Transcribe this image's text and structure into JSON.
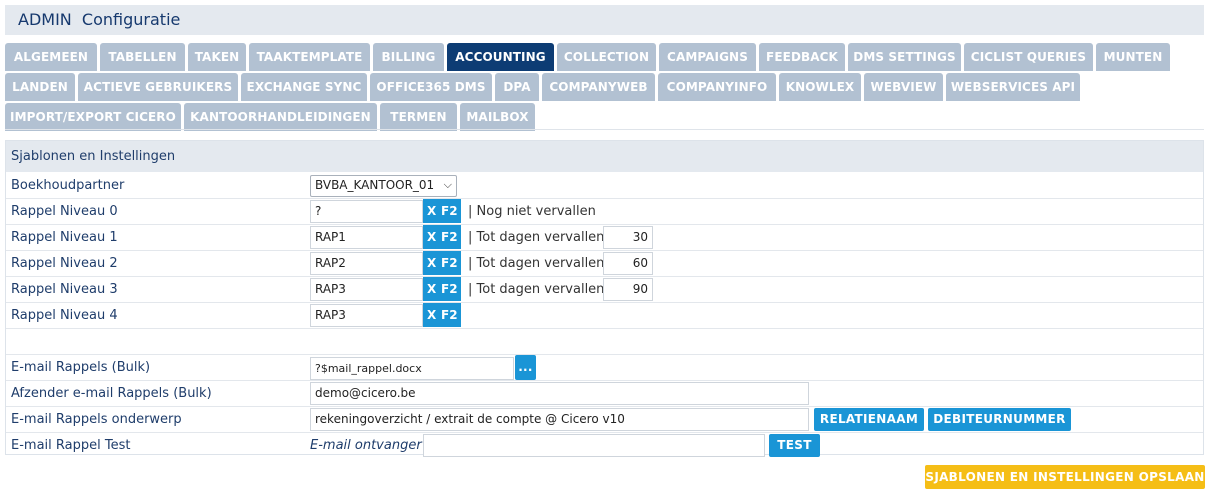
{
  "header": {
    "title": "ADMIN  Configuratie"
  },
  "tabs": {
    "row1": [
      "ALGEMEEN",
      "TABELLEN",
      "TAKEN",
      "TAAKTEMPLATE",
      "BILLING",
      "ACCOUNTING",
      "COLLECTION",
      "CAMPAIGNS",
      "FEEDBACK",
      "DMS SETTINGS",
      "CICLIST QUERIES",
      "MUNTEN"
    ],
    "row2": [
      "LANDEN",
      "ACTIEVE GEBRUIKERS",
      "EXCHANGE SYNC",
      "OFFICE365 DMS",
      "DPA",
      "COMPANYWEB",
      "COMPANYINFO",
      "KNOWLEX",
      "WEBVIEW",
      "WEBSERVICES API"
    ],
    "row3": [
      "IMPORT/EXPORT CICERO",
      "KANTOORHANDLEIDINGEN",
      "TERMEN",
      "MAILBOX"
    ],
    "active": "ACCOUNTING"
  },
  "panel": {
    "title": "Sjablonen en Instellingen",
    "boekhoudpartner": {
      "label": "Boekhoudpartner",
      "value": "BVBA_KANTOOR_01"
    },
    "rappel0": {
      "label": "Rappel Niveau 0",
      "value": "?",
      "x": "X",
      "f2": "F2",
      "note": "| Nog niet vervallen"
    },
    "rappel1": {
      "label": "Rappel Niveau 1",
      "value": "RAP1",
      "x": "X",
      "f2": "F2",
      "note": "| Tot dagen vervallen",
      "days": "30"
    },
    "rappel2": {
      "label": "Rappel Niveau 2",
      "value": "RAP2",
      "x": "X",
      "f2": "F2",
      "note": "| Tot dagen vervallen",
      "days": "60"
    },
    "rappel3": {
      "label": "Rappel Niveau 3",
      "value": "RAP3",
      "x": "X",
      "f2": "F2",
      "note": "| Tot dagen vervallen",
      "days": "90"
    },
    "rappel4": {
      "label": "Rappel Niveau 4",
      "value": "RAP3",
      "x": "X",
      "f2": "F2"
    },
    "email_bulk": {
      "label": "E-mail Rappels (Bulk)",
      "value": "?$mail_rappel.docx",
      "browse": "..."
    },
    "afzender": {
      "label": "Afzender e-mail Rappels (Bulk)",
      "value": "demo@cicero.be"
    },
    "onderwerp": {
      "label": "E-mail Rappels onderwerp",
      "value": "rekeningoverzicht / extrait de compte @ Cicero v10",
      "btn_relatie": "RELATIENAAM",
      "btn_debiteur": "DEBITEURNUMMER"
    },
    "test": {
      "label": "E-mail Rappel Test",
      "ontvanger_label": "E-mail ontvanger",
      "value": "",
      "btn": "TEST"
    }
  },
  "save_button": "SJABLONEN EN INSTELLINGEN OPSLAAN",
  "colors": {
    "tab": "#b2c1d2",
    "tab_active": "#0d3c74",
    "button": "#1a95d6",
    "save": "#f5be16"
  }
}
